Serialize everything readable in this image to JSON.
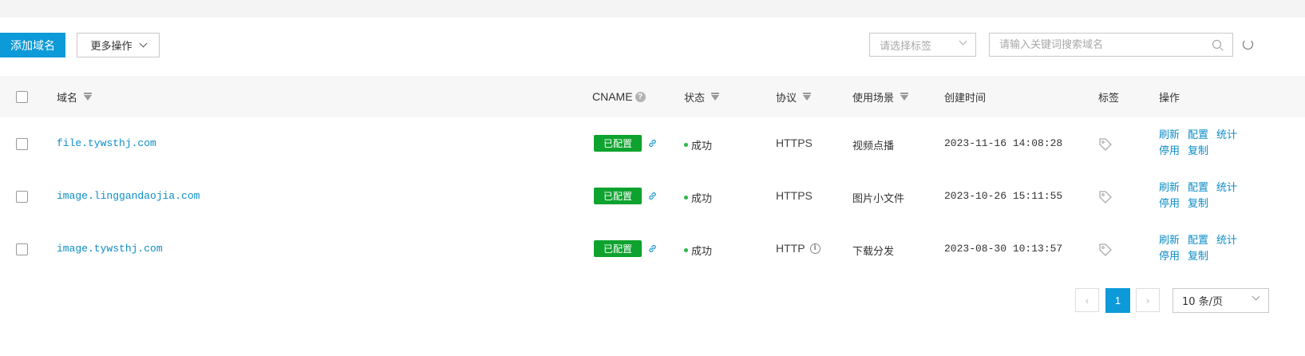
{
  "toolbar": {
    "add_label": "添加域名",
    "more_label": "更多操作",
    "tag_select_placeholder": "请选择标签",
    "search_placeholder": "请输入关键词搜索域名"
  },
  "table": {
    "headers": {
      "domain": "域名",
      "cname": "CNAME",
      "status": "状态",
      "protocol": "协议",
      "scene": "使用场景",
      "created": "创建时间",
      "tags": "标签",
      "actions": "操作"
    },
    "rows": [
      {
        "domain": "file.tywsthj.com",
        "cname_badge": "已配置",
        "status": "成功",
        "protocol": "HTTPS",
        "scene": "视频点播",
        "created": "2023-11-16 14:08:28",
        "ops": [
          "刷新",
          "配置",
          "统计",
          "停用",
          "复制"
        ]
      },
      {
        "domain": "image.linggandaojia.com",
        "cname_badge": "已配置",
        "status": "成功",
        "protocol": "HTTPS",
        "scene": "图片小文件",
        "created": "2023-10-26 15:11:55",
        "ops": [
          "刷新",
          "配置",
          "统计",
          "停用",
          "复制"
        ]
      },
      {
        "domain": "image.tywsthj.com",
        "cname_badge": "已配置",
        "status": "成功",
        "protocol": "HTTP",
        "scene": "下载分发",
        "created": "2023-08-30 10:13:57",
        "ops": [
          "刷新",
          "配置",
          "统计",
          "停用",
          "复制"
        ]
      }
    ]
  },
  "pagination": {
    "current_page": "1",
    "page_size_label": "10 条/页",
    "prev_symbol": "‹",
    "next_symbol": "›"
  },
  "colors": {
    "primary": "#0c9ad8",
    "link": "#0c8dc7",
    "badge_green": "#0ea22f",
    "status_dot": "#2db74a"
  }
}
